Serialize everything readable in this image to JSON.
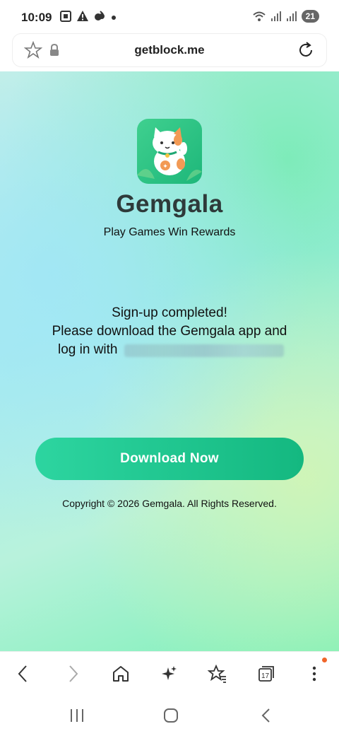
{
  "status": {
    "time": "10:09",
    "battery": "21",
    "icons": [
      "screenshot-icon",
      "alert-icon",
      "cloud-icon",
      "dot-icon",
      "wifi-icon",
      "signal-icon",
      "signal-icon",
      "battery-icon"
    ]
  },
  "browser": {
    "url": "getblock.me"
  },
  "page": {
    "brand": "Gemgala",
    "tagline": "Play Games Win Rewards",
    "message_line1": "Sign-up completed!",
    "message_line2": "Please download the Gemgala app and",
    "message_line3": "log in with",
    "download_label": "Download Now",
    "copyright": "Copyright © 2026 Gemgala. All Rights Reserved."
  },
  "toolbar": {
    "tabs_count": "17",
    "icons": [
      "back-icon",
      "forward-icon",
      "home-icon",
      "sparkle-icon",
      "bookmarks-icon",
      "tabs-icon",
      "more-icon"
    ]
  },
  "colors": {
    "accent": "#1fc48a",
    "notification": "#f0652a"
  }
}
